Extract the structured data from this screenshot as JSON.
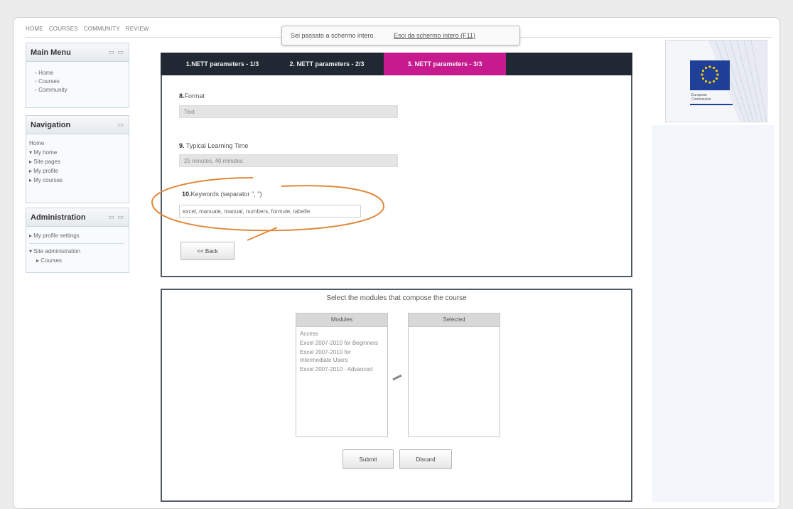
{
  "topnav": {
    "items": [
      "HOME",
      "COURSES",
      "COMMUNITY",
      "REVIEW"
    ]
  },
  "fullscreen": {
    "text": "Sei passato a schermo intero.",
    "exit": "Esci da schermo intero (F11)"
  },
  "blocks": {
    "main_menu": {
      "title": "Main Menu",
      "controls": "▭ ▭",
      "items": [
        "Home",
        "Courses",
        "Community"
      ]
    },
    "navigation": {
      "title": "Navigation",
      "controls": "▭",
      "home": "Home",
      "items": [
        "My home",
        "Site pages",
        "My profile",
        "My courses"
      ]
    },
    "administration": {
      "title": "Administration",
      "controls": "▭ ▭",
      "items": [
        "My profile settings",
        "Site administration"
      ],
      "sub": "Courses"
    }
  },
  "tabs": [
    "1.NETT parameters - 1/3",
    "2. NETT parameters - 2/3",
    "3. NETT parameters - 3/3"
  ],
  "fields": {
    "format": {
      "num": "8.",
      "label": "Format",
      "value": "Text"
    },
    "time": {
      "num": "9.",
      "label": "Typical Learning Time",
      "value": "25 minutes, 40 minutes"
    },
    "keywords": {
      "num": "10.",
      "label": "Keywords (separator \", \")",
      "value": "excel, manuale, manual, numbers, formule, tabelle"
    }
  },
  "back_button": "<< Back",
  "modules": {
    "title": "Select the modules that compose the course",
    "left_header": "Modules",
    "right_header": "Selected",
    "options": [
      "Access",
      "Excel 2007-2010 for Beginners",
      "Excel 2007-2010 for Intermediate Users",
      "Excel 2007-2010 - Advanced"
    ]
  },
  "submit_label": "Submit",
  "discard_label": "Discard",
  "logo": {
    "line1": "European",
    "line2": "Commission"
  },
  "colors": {
    "active_tab": "#c71a8e",
    "tab_bar": "#1f2833",
    "highlight_ring": "#e08a3c",
    "eu_blue": "#1f3f99",
    "eu_star": "#f5d300"
  }
}
